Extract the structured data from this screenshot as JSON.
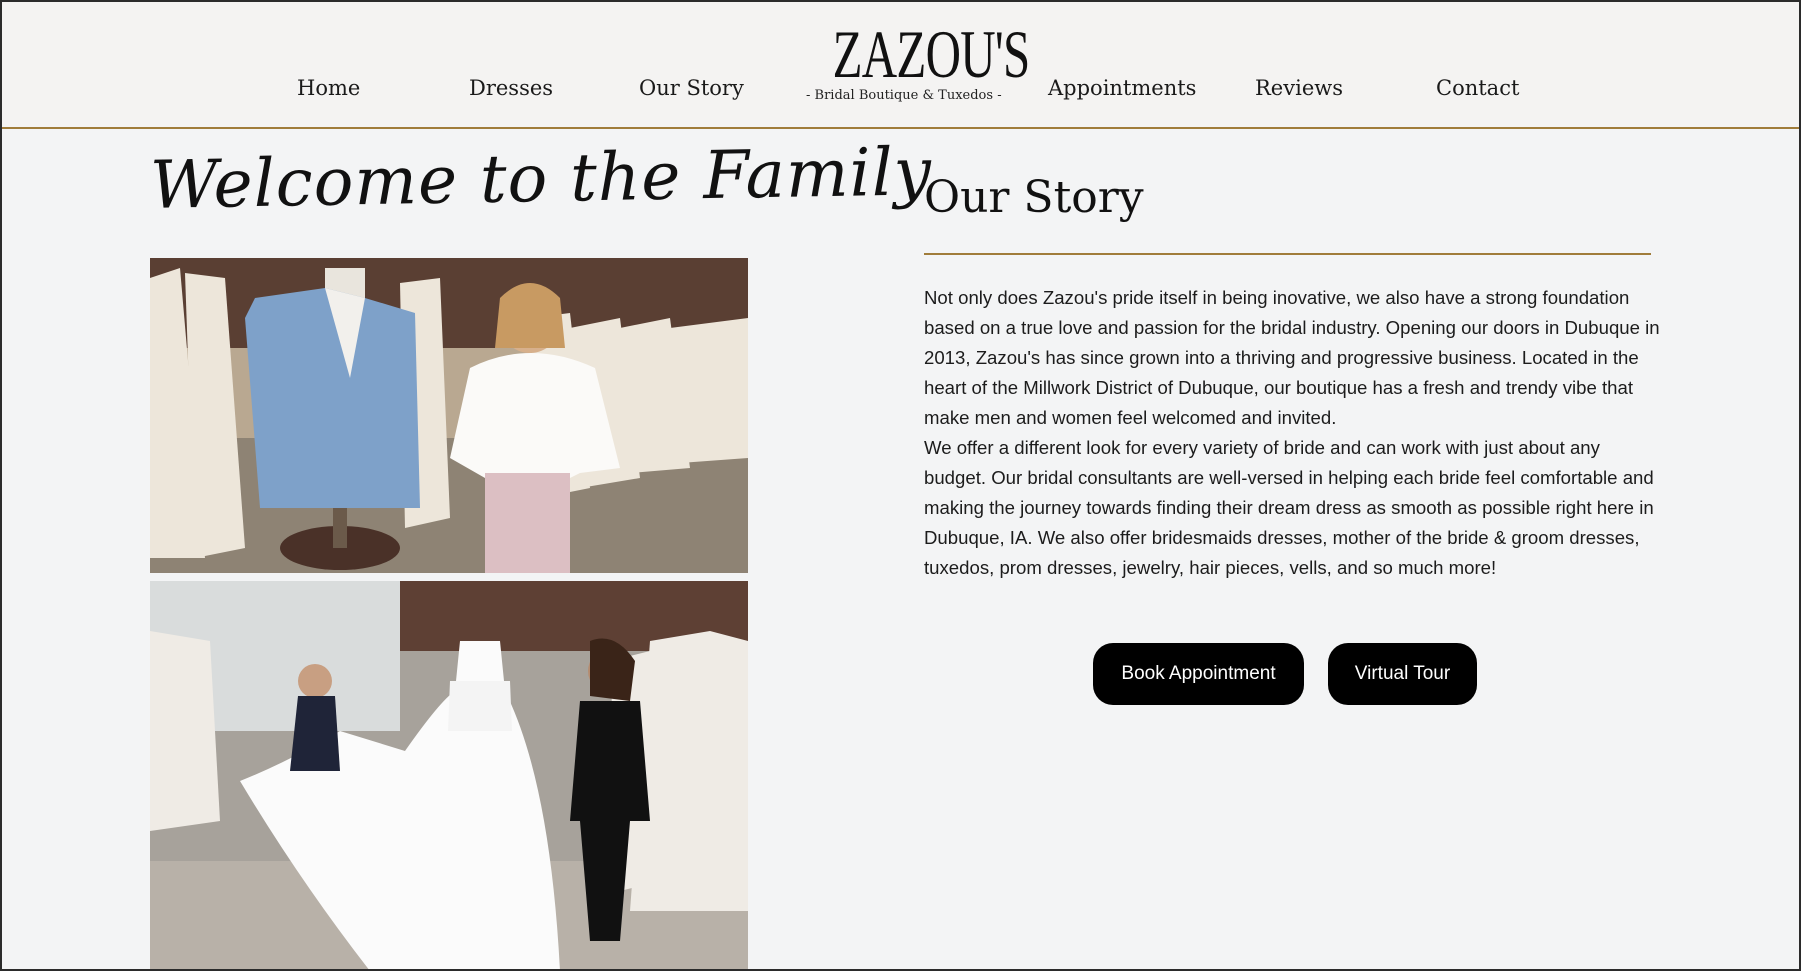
{
  "nav": {
    "home": "Home",
    "dresses": "Dresses",
    "our_story": "Our Story",
    "appointments": "Appointments",
    "reviews": "Reviews",
    "contact": "Contact"
  },
  "logo": {
    "name": "ZAZOU'S",
    "tagline": "- Bridal Boutique & Tuxedos -"
  },
  "welcome": {
    "heading": "Welcome to the Family"
  },
  "story": {
    "title": "Our Story",
    "paragraph1": "Not only does Zazou's pride itself in being inovative, we also have a strong foundation based on a true love and passion for the bridal industry. Opening our doors in Dubuque in 2013, Zazou's has since grown into a thriving and progressive business. Located in the heart of the Millwork District of Dubuque, our boutique has a fresh and trendy vibe that make men and women feel welcomed and invited.",
    "paragraph2": "We offer a different look for every variety of bride and can work with just about any budget. Our bridal consultants are well-versed in helping each bride feel comfortable and making the journey towards finding their dream dress as smooth as possible right here in Dubuque, IA. We also offer bridesmaids dresses, mother of the bride & groom dresses, tuxedos, prom dresses, jewelry, hair pieces, vells, and so much more!"
  },
  "buttons": {
    "book": "Book Appointment",
    "tour": "Virtual Tour"
  },
  "colors": {
    "accent_gold": "#a07c3a",
    "button_bg": "#000000",
    "page_bg": "#f3f4f5"
  }
}
